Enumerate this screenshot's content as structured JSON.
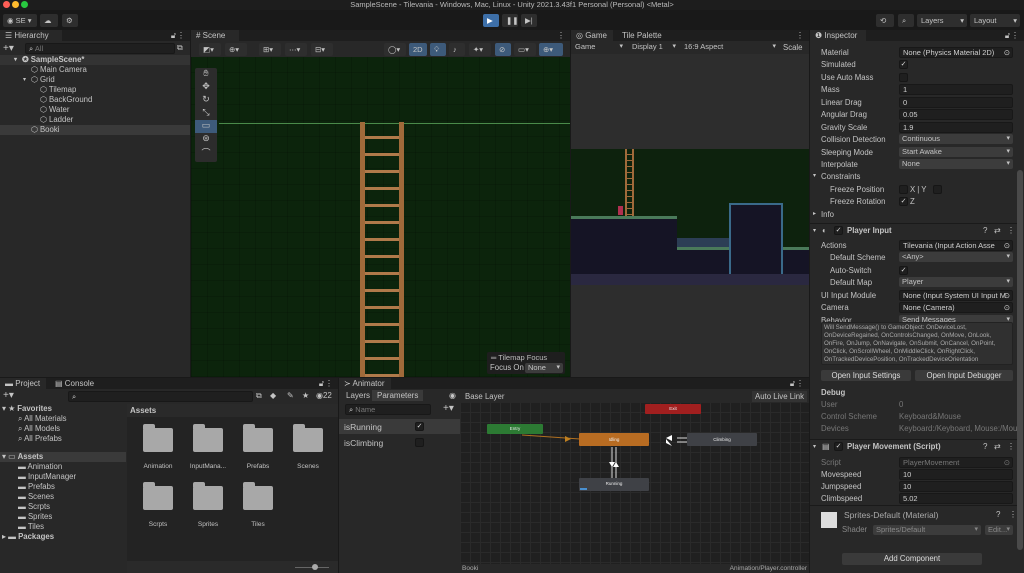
{
  "window": {
    "title": "SampleScene - Tilevania - Windows, Mac, Linux - Unity 2021.3.43f1 Personal (Personal) <Metal>"
  },
  "toolbar": {
    "account": "SE",
    "layers": "Layers",
    "layout": "Layout"
  },
  "hierarchy": {
    "tab": "Hierarchy",
    "search_placeholder": "All",
    "items": [
      {
        "label": "SampleScene*",
        "depth": 0
      },
      {
        "label": "Main Camera",
        "depth": 1
      },
      {
        "label": "Grid",
        "depth": 1
      },
      {
        "label": "Tilemap",
        "depth": 2
      },
      {
        "label": "BackGround",
        "depth": 2
      },
      {
        "label": "Water",
        "depth": 2
      },
      {
        "label": "Ladder",
        "depth": 2
      },
      {
        "label": "Booki",
        "depth": 1
      }
    ]
  },
  "scene": {
    "tab": "Scene",
    "mode_2d": "2D",
    "overlay_title": "Tilemap Focus",
    "focus_label": "Focus On",
    "focus_value": "None"
  },
  "game": {
    "tabs": [
      "Game",
      "Tile Palette"
    ],
    "mode": "Game",
    "display": "Display 1",
    "aspect": "16:9 Aspect",
    "scale": "Scale"
  },
  "inspector": {
    "tab": "Inspector",
    "rows": [
      {
        "label": "Material",
        "kind": "ref",
        "value": "None (Physics Material 2D)"
      },
      {
        "label": "Simulated",
        "kind": "check",
        "value": "✓"
      },
      {
        "label": "Use Auto Mass",
        "kind": "check",
        "value": ""
      },
      {
        "label": "Mass",
        "kind": "field",
        "value": "1"
      },
      {
        "label": "Linear Drag",
        "kind": "field",
        "value": "0"
      },
      {
        "label": "Angular Drag",
        "kind": "field",
        "value": "0.05"
      },
      {
        "label": "Gravity Scale",
        "kind": "field",
        "value": "1.9"
      },
      {
        "label": "Collision Detection",
        "kind": "dd",
        "value": "Continuous"
      },
      {
        "label": "Sleeping Mode",
        "kind": "dd",
        "value": "Start Awake"
      },
      {
        "label": "Interpolate",
        "kind": "dd",
        "value": "None"
      },
      {
        "label": "Constraints",
        "kind": "fold",
        "value": ""
      },
      {
        "label": "Freeze Position",
        "kind": "xy",
        "value": "X|Y",
        "indent": 1
      },
      {
        "label": "Freeze Rotation",
        "kind": "z",
        "value": "Z",
        "indent": 1
      },
      {
        "label": "Info",
        "kind": "foldc",
        "value": ""
      },
      {
        "label": "Player Input",
        "kind": "header",
        "value": ""
      },
      {
        "label": "Actions",
        "kind": "ref",
        "value": "Tilevania (Input Action Asse"
      },
      {
        "label": "Default Scheme",
        "kind": "dd",
        "value": "<Any>",
        "indent": 1
      },
      {
        "label": "Auto-Switch",
        "kind": "check",
        "value": "✓",
        "indent": 1
      },
      {
        "label": "Default Map",
        "kind": "dd",
        "value": "Player",
        "indent": 1
      },
      {
        "label": "UI Input Module",
        "kind": "ref",
        "value": "None (Input System UI Input M"
      },
      {
        "label": "Camera",
        "kind": "ref",
        "value": "None (Camera)"
      },
      {
        "label": "Behavior",
        "kind": "dd",
        "value": "Send Messages"
      },
      {
        "label": "",
        "kind": "help",
        "value": "Will SendMessage() to GameObject: OnDeviceLost, OnDeviceRegained, OnControlsChanged, OnMove, OnLook, OnFire, OnJump, OnNavigate, OnSubmit, OnCancel, OnPoint, OnClick, OnScrollWheel, OnMiddleClick, OnRightClick, OnTrackedDevicePosition, OnTrackedDeviceOrientation"
      },
      {
        "label": "Open Input Settings",
        "kind": "buttons",
        "value": "Open Input Debugger"
      },
      {
        "label": "Debug",
        "kind": "bold",
        "value": ""
      },
      {
        "label": "User",
        "kind": "ro",
        "value": "0"
      },
      {
        "label": "Control Scheme",
        "kind": "ro",
        "value": "Keyboard&Mouse"
      },
      {
        "label": "Devices",
        "kind": "ro",
        "value": "Keyboard:/Keyboard, Mouse:/Mou"
      },
      {
        "label": "Player Movement (Script)",
        "kind": "header",
        "value": ""
      },
      {
        "label": "Script",
        "kind": "roref",
        "value": "PlayerMovement"
      },
      {
        "label": "Movespeed",
        "kind": "field",
        "value": "10"
      },
      {
        "label": "Jumpspeed",
        "kind": "field",
        "value": "10"
      },
      {
        "label": "Climbspeed",
        "kind": "field",
        "value": "5.02"
      }
    ],
    "material": {
      "name": "Sprites-Default (Material)",
      "shader_label": "Shader",
      "shader": "Sprites/Default",
      "edit": "Edit..."
    },
    "add_component": "Add Component"
  },
  "project": {
    "tabs": [
      "Project",
      "Console"
    ],
    "hidden_count": "22",
    "favorites": "Favorites",
    "fav_items": [
      "All Materials",
      "All Models",
      "All Prefabs"
    ],
    "assets": "Assets",
    "asset_items": [
      "Animation",
      "InputManager",
      "Prefabs",
      "Scenes",
      "Scrpts",
      "Sprites",
      "Tiles"
    ],
    "packages": "Packages",
    "breadcrumb": "Assets",
    "grid": [
      "Animation",
      "InputMana...",
      "Prefabs",
      "Scenes",
      "Scrpts",
      "Sprites",
      "Tiles"
    ]
  },
  "animator": {
    "tab": "Animator",
    "subtabs": [
      "Layers",
      "Parameters"
    ],
    "search_placeholder": "Name",
    "params": [
      {
        "name": "isRunning",
        "value": true
      },
      {
        "name": "isClimbing",
        "value": false
      }
    ],
    "layer": "Base Layer",
    "live_link": "Auto Live Link",
    "states": {
      "exit": "Exit",
      "entry": "Entry",
      "idling": "Idling",
      "climbing": "Climbing",
      "running": "Running"
    },
    "footer_left": "Booki",
    "footer_right": "Animation/Player.controller"
  }
}
